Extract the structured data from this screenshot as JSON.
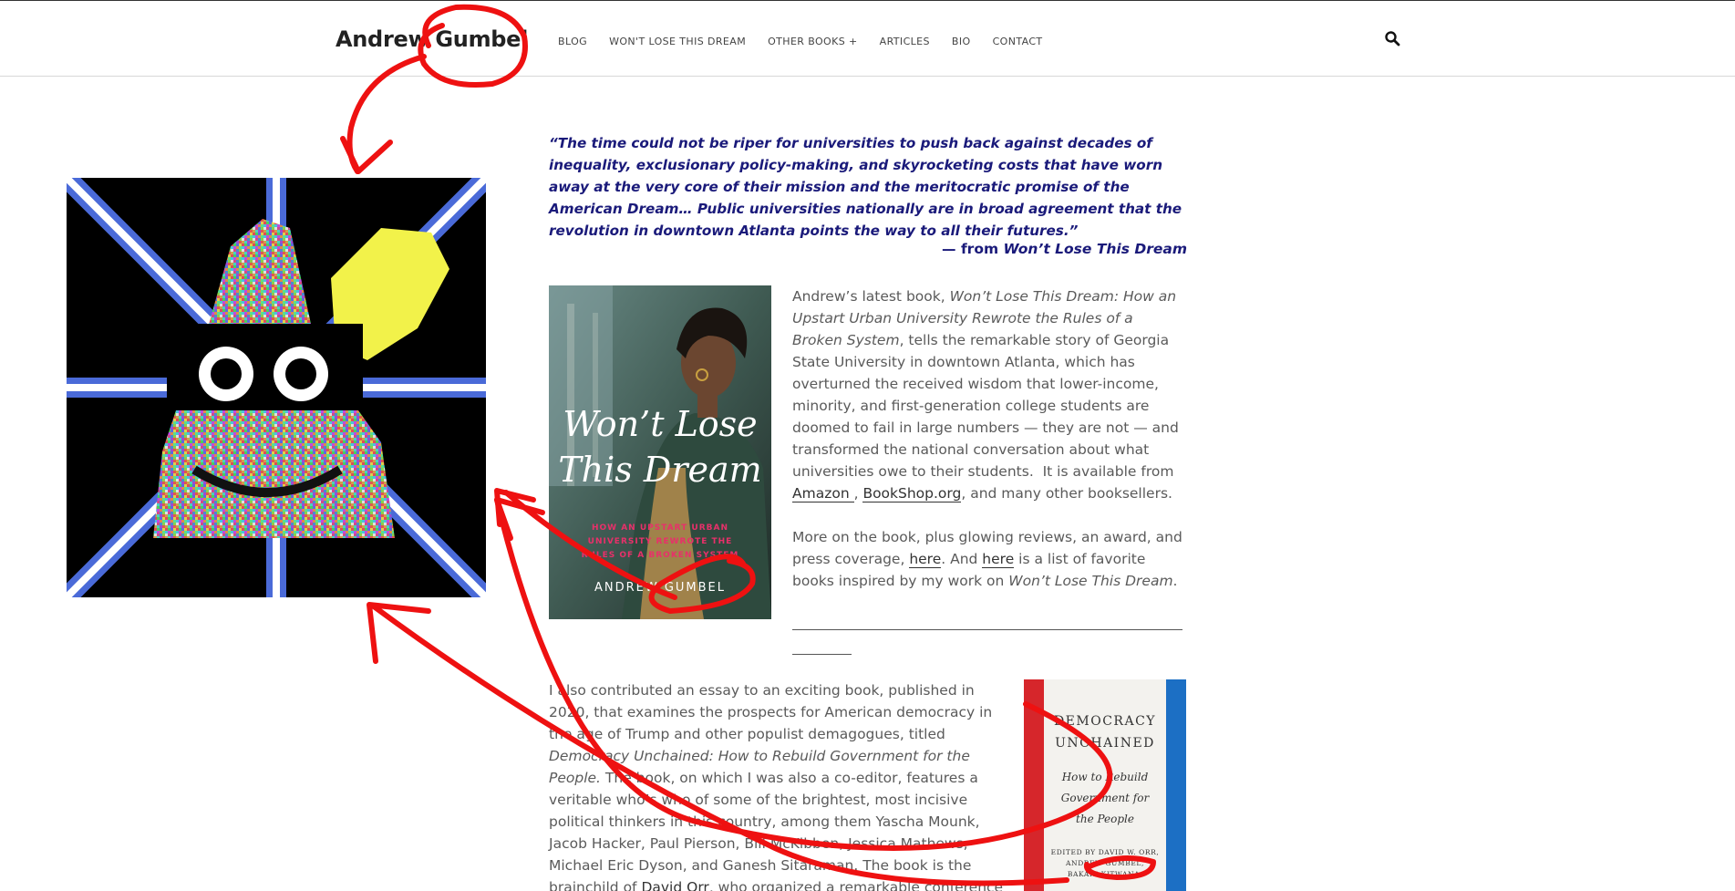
{
  "header": {
    "site_title": "Andrew Gumbel",
    "nav": [
      "BLOG",
      "WON'T LOSE THIS DREAM",
      "OTHER BOOKS +",
      "ARTICLES",
      "BIO",
      "CONTACT"
    ],
    "search_icon": "search-icon"
  },
  "quote": {
    "text": "“The time could not be riper for universities to push back against decades of inequality, exclusionary policy-making, and skyrocketing costs that have worn away at the very core of their mission and the meritocratic promise of the American Dream… Public universities nationally are in broad agreement that the revolution in downtown Atlanta points the way to all their futures.”",
    "attribution_prefix": "— from ",
    "attribution_title": "Won’t Lose This Dream"
  },
  "book1": {
    "title_line1": "Won’t Lose",
    "title_line2": "This Dream",
    "subtitle_line1": "HOW AN  UPSTART URBAN",
    "subtitle_line2": "UNIVERSITY REWROTE THE",
    "subtitle_line3": "RULES OF A BROKEN SYSTEM",
    "author": "ANDREW GUMBEL"
  },
  "para1": {
    "a": "Andrew’s latest book, ",
    "title": "Won’t Lose This Dream: How an Upstart Urban University Rewrote the Rules of a Broken System",
    "b": ", tells the remarkable story of Georgia State University in downtown Atlanta, which has overturned the received wisdom that lower-income, minority, and first-generation college students are doomed to fail in large numbers — they are not — and transformed the national conversation about what universities owe to their students.  It is available from ",
    "link_amazon": "Amazon ",
    "c": ", ",
    "link_bookshop": "BookShop.org",
    "d": ", and many other booksellers."
  },
  "para2": {
    "a": "More on the book, plus glowing reviews, an award, and press coverage, ",
    "link_here1": "here",
    "b": ". And ",
    "link_here2": "here",
    "c": " is a list of favorite books inspired by my work on ",
    "title": "Won’t Lose This Dream",
    "d": "."
  },
  "para3": {
    "a": "I also contributed an essay to an exciting book, published in 2020, that examines the prospects for American democracy in the age of Trump and other populist demagogues, titled ",
    "title": "Democracy Unchained: How to Rebuild Government for the People.",
    "b": " The book, on which I was also a co-editor, features a veritable who’s who of some of the brightest, most incisive political thinkers in this country, among them Yascha Mounk, Jacob Hacker, Paul Pierson, Bill McKibben, Jessica Mathews, Michael Eric Dyson, and Ganesh Sitaraman. The book is the brainchild of ",
    "link_orr": "David Orr",
    "c": ", who organized a remarkable conference on the state of American democracy at"
  },
  "book2": {
    "title_line1": "DEMOCRACY",
    "title_line2": "UNCHAINED",
    "sub_line1": "How to Rebuild",
    "sub_line2": "Government for",
    "sub_line3": "the People",
    "editors_line1": "EDITED BY DAVID W. ORR,",
    "editors_line2": "ANDREW GUMBEL,",
    "editors_line3": "BAKARI KITWANA,"
  },
  "colors": {
    "quote_blue": "#1a1a7a",
    "annotation_red": "#ee1111",
    "art_yellow": "#f2f24a"
  }
}
